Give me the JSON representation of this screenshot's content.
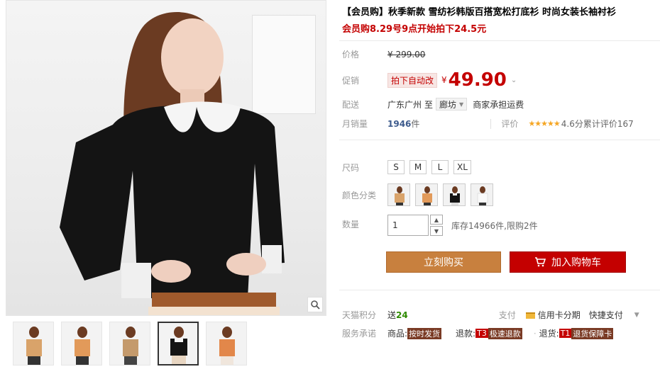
{
  "product": {
    "title": "【会员购】秋季新款 雪纺衫韩版百搭宽松打底衫 时尚女装长袖衬衫",
    "promo": "会员购8.29号9点开始拍下24.5元"
  },
  "price": {
    "label": "价格",
    "original": "¥ 299.00"
  },
  "promo_price": {
    "label": "促销",
    "tag": "拍下自动改",
    "currency": "¥",
    "value": "49.90"
  },
  "shipping": {
    "label": "配送",
    "from": "广东广州",
    "to_word": "至",
    "destination": "廊坊",
    "fee_note": "商家承担运费"
  },
  "monthly": {
    "label": "月销量",
    "count": "1946",
    "unit": "件",
    "rating_label": "评价",
    "stars": "★★★★★",
    "rating_text": "4.6分累计评价167",
    "rating_value": 4.6
  },
  "size": {
    "label": "尺码",
    "options": [
      "S",
      "M",
      "L",
      "XL"
    ]
  },
  "color": {
    "label": "颜色分类",
    "count_swatches": 4
  },
  "quantity": {
    "label": "数量",
    "value": "1",
    "stock_text": "库存14966件,限购2件"
  },
  "buttons": {
    "buy": "立刻购买",
    "cart": "加入购物车"
  },
  "points": {
    "label": "天猫积分",
    "send_word": "送",
    "amount": "24",
    "pay_label": "支付",
    "credit": "信用卡分期",
    "quick": "快捷支付"
  },
  "promise": {
    "label": "服务承诺",
    "goods_word": "商品:",
    "goods_badge": "按时发货",
    "refund_word": "退款:",
    "refund_badge_prefix": "T3",
    "refund_badge": "极速退款",
    "return_word": "退货:",
    "return_badge_prefix": "T1",
    "return_badge": "退货保障卡"
  },
  "colors": {
    "accent_red": "#c40000",
    "buy_orange": "#c8803e",
    "sales_blue": "#3c5a8c"
  }
}
